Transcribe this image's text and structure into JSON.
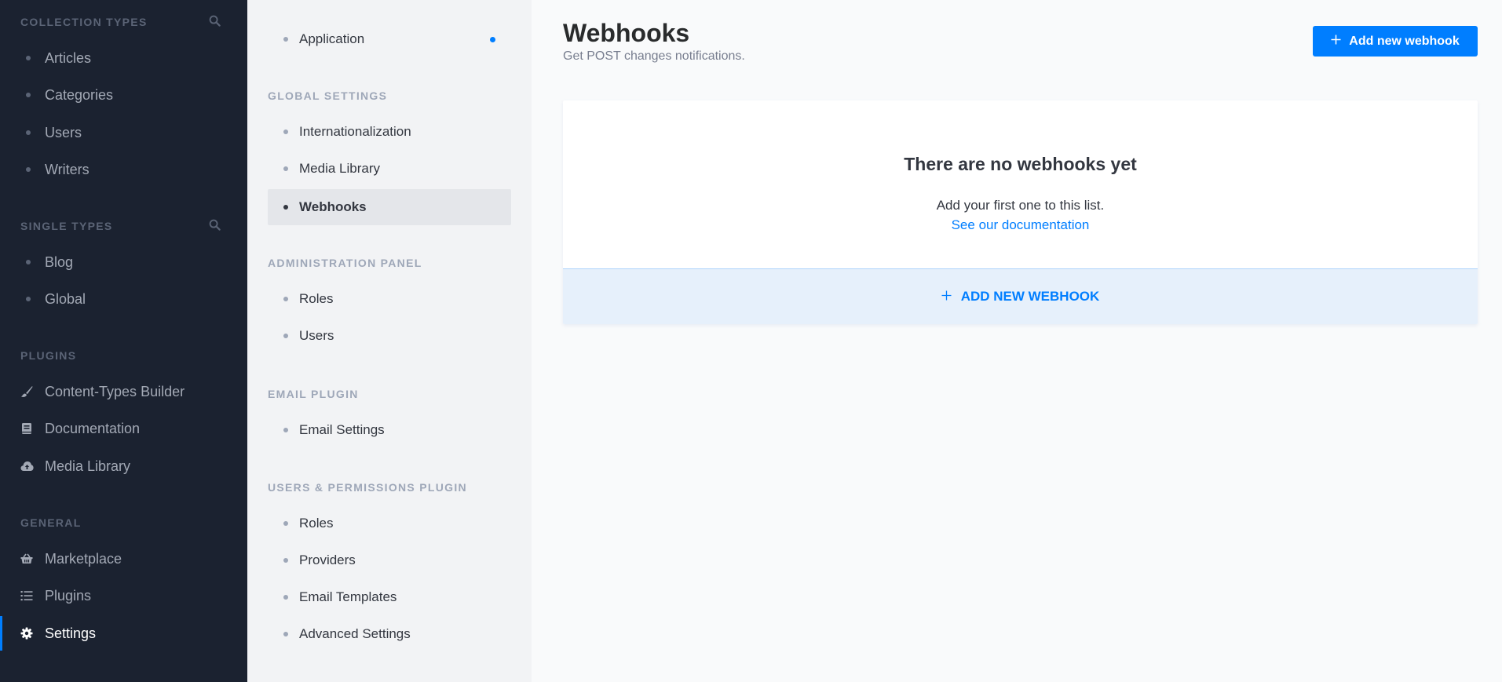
{
  "sidebar": {
    "sections": {
      "collection_types": "COLLECTION TYPES",
      "single_types": "SINGLE TYPES",
      "plugins": "PLUGINS",
      "general": "GENERAL"
    },
    "collection_items": [
      {
        "label": "Articles"
      },
      {
        "label": "Categories"
      },
      {
        "label": "Users"
      },
      {
        "label": "Writers"
      }
    ],
    "single_items": [
      {
        "label": "Blog"
      },
      {
        "label": "Global"
      }
    ],
    "plugin_items": [
      {
        "label": "Content-Types Builder",
        "icon": "paintbrush-icon"
      },
      {
        "label": "Documentation",
        "icon": "book-icon"
      },
      {
        "label": "Media Library",
        "icon": "cloud-upload-icon"
      }
    ],
    "general_items": [
      {
        "label": "Marketplace",
        "icon": "basket-icon"
      },
      {
        "label": "Plugins",
        "icon": "list-icon"
      },
      {
        "label": "Settings",
        "icon": "gear-icon",
        "active": true
      }
    ]
  },
  "subnav": {
    "top_items": [
      {
        "label": "Application",
        "badge": true
      }
    ],
    "sections": {
      "global_settings": "GLOBAL SETTINGS",
      "administration_panel": "ADMINISTRATION PANEL",
      "email_plugin": "EMAIL PLUGIN",
      "users_permissions_plugin": "USERS & PERMISSIONS PLUGIN"
    },
    "global_items": [
      {
        "label": "Internationalization"
      },
      {
        "label": "Media Library"
      },
      {
        "label": "Webhooks",
        "active": true
      }
    ],
    "admin_items": [
      {
        "label": "Roles"
      },
      {
        "label": "Users"
      }
    ],
    "email_items": [
      {
        "label": "Email Settings"
      }
    ],
    "up_items": [
      {
        "label": "Roles"
      },
      {
        "label": "Providers"
      },
      {
        "label": "Email Templates"
      },
      {
        "label": "Advanced Settings"
      }
    ]
  },
  "main": {
    "title": "Webhooks",
    "subtitle": "Get POST changes notifications.",
    "add_button_label": "Add new webhook",
    "empty_title": "There are no webhooks yet",
    "empty_text": "Add your first one to this list.",
    "doc_link": "See our documentation",
    "add_row_label": "ADD NEW WEBHOOK"
  },
  "colors": {
    "sidebar_bg": "#1b2230",
    "accent": "#007eff",
    "subnav_bg": "#f2f3f5",
    "main_bg": "#f9fafb"
  }
}
